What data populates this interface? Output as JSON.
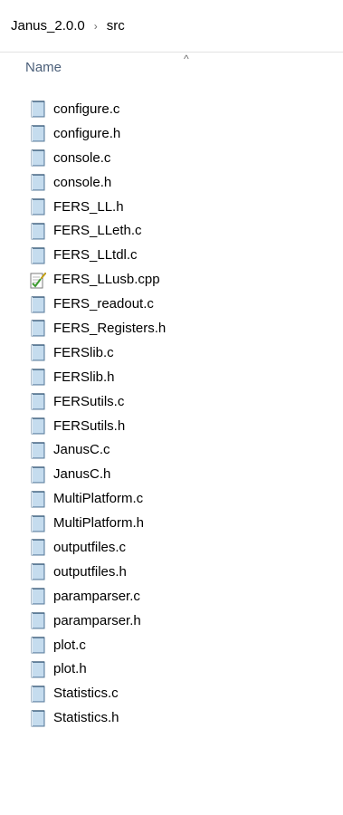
{
  "breadcrumb": {
    "items": [
      "Janus_2.0.0",
      "src"
    ],
    "separator": "›"
  },
  "header": {
    "name_label": "Name",
    "sort_indicator": "^"
  },
  "files": [
    {
      "name": "configure.c",
      "icon": "c-file-icon"
    },
    {
      "name": "configure.h",
      "icon": "h-file-icon"
    },
    {
      "name": "console.c",
      "icon": "c-file-icon"
    },
    {
      "name": "console.h",
      "icon": "h-file-icon"
    },
    {
      "name": "FERS_LL.h",
      "icon": "h-file-icon"
    },
    {
      "name": "FERS_LLeth.c",
      "icon": "c-file-icon"
    },
    {
      "name": "FERS_LLtdl.c",
      "icon": "c-file-icon"
    },
    {
      "name": "FERS_LLusb.cpp",
      "icon": "cpp-file-icon"
    },
    {
      "name": "FERS_readout.c",
      "icon": "c-file-icon"
    },
    {
      "name": "FERS_Registers.h",
      "icon": "h-file-icon"
    },
    {
      "name": "FERSlib.c",
      "icon": "c-file-icon"
    },
    {
      "name": "FERSlib.h",
      "icon": "h-file-icon"
    },
    {
      "name": "FERSutils.c",
      "icon": "c-file-icon"
    },
    {
      "name": "FERSutils.h",
      "icon": "h-file-icon"
    },
    {
      "name": "JanusC.c",
      "icon": "c-file-icon"
    },
    {
      "name": "JanusC.h",
      "icon": "h-file-icon"
    },
    {
      "name": "MultiPlatform.c",
      "icon": "c-file-icon"
    },
    {
      "name": "MultiPlatform.h",
      "icon": "h-file-icon"
    },
    {
      "name": "outputfiles.c",
      "icon": "c-file-icon"
    },
    {
      "name": "outputfiles.h",
      "icon": "h-file-icon"
    },
    {
      "name": "paramparser.c",
      "icon": "c-file-icon"
    },
    {
      "name": "paramparser.h",
      "icon": "h-file-icon"
    },
    {
      "name": "plot.c",
      "icon": "c-file-icon"
    },
    {
      "name": "plot.h",
      "icon": "h-file-icon"
    },
    {
      "name": "Statistics.c",
      "icon": "c-file-icon"
    },
    {
      "name": "Statistics.h",
      "icon": "h-file-icon"
    }
  ],
  "colors": {
    "header_text": "#4c607a",
    "file_icon_fill": "#a9c6df",
    "file_icon_edge": "#5e7f9c",
    "cpp_icon_check": "#3d9b2f",
    "cpp_icon_pencil": "#e0b400"
  }
}
